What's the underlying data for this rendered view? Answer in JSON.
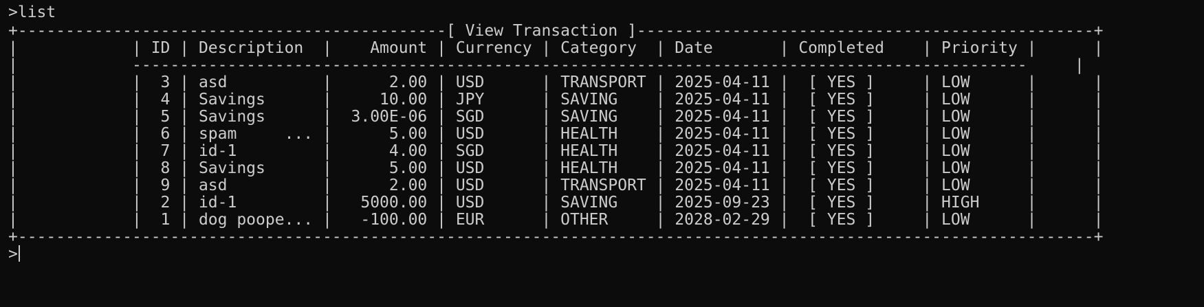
{
  "terminal": {
    "command_line": ">list",
    "lines": [
      "+---------------------------------------------[ View Transaction ]------------------------------------------------+",
      "|            | ID | Description  |    Amount | Currency | Category  | Date       | Completed    | Priority |      |",
      "|            ----------------------------------------------------------------------------------------------     |",
      "|            |  3 | asd          |      2.00 | USD      | TRANSPORT | 2025-04-11 |  [ YES ]     | LOW      |      |",
      "|            |  4 | Savings      |     10.00 | JPY      | SAVING    | 2025-04-11 |  [ YES ]     | LOW      |      |",
      "|            |  5 | Savings      |  3.00E-06 | SGD      | SAVING    | 2025-04-11 |  [ YES ]     | LOW      |      |",
      "|            |  6 | spam     ... |      5.00 | USD      | HEALTH    | 2025-04-11 |  [ YES ]     | LOW      |      |",
      "|            |  7 | id-1         |      4.00 | SGD      | HEALTH    | 2025-04-11 |  [ YES ]     | LOW      |      |",
      "|            |  8 | Savings      |      5.00 | USD      | HEALTH    | 2025-04-11 |  [ YES ]     | LOW      |      |",
      "|            |  9 | asd          |      2.00 | USD      | TRANSPORT | 2025-04-11 |  [ YES ]     | LOW      |      |",
      "|            |  2 | id-1         |   5000.00 | USD      | SAVING    | 2025-09-23 |  [ YES ]     | HIGH     |      |",
      "|            |  1 | dog poope... |   -100.00 | EUR      | OTHER     | 2028-02-29 |  [ YES ]     | LOW      |      |",
      "+-----------------------------------------------------------------------------------------------------------------+"
    ],
    "prompt": ">"
  }
}
